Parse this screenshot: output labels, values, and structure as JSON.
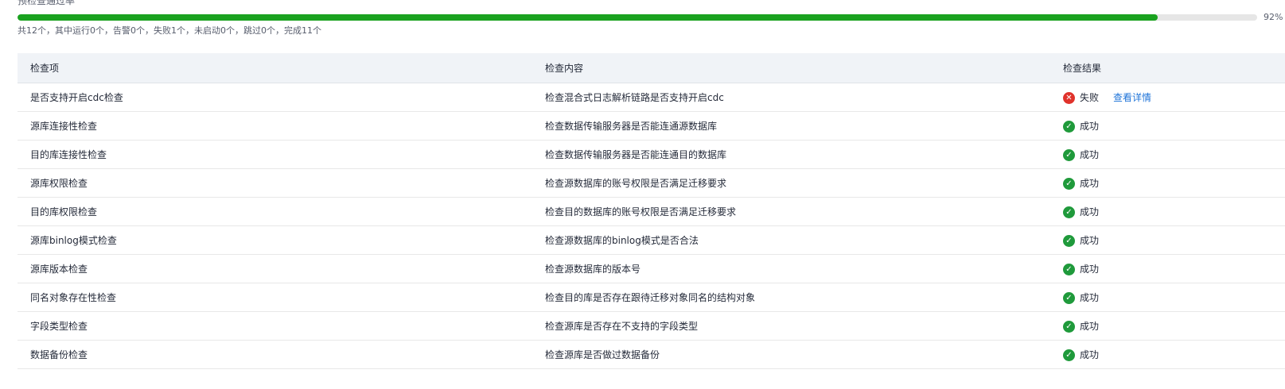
{
  "precheck": {
    "title": "预检查通过率",
    "progress_percent": 92,
    "progress_label": "92%",
    "summary": "共12个，其中运行0个，告警0个，失败1个，未启动0个，跳过0个，完成11个",
    "colors": {
      "progress": "#1aa21f",
      "track": "#e6e6e6",
      "success": "#1f9a3b",
      "fail": "#e0322b",
      "link": "#1e73d8",
      "header_bg": "#f0f3f7"
    }
  },
  "table": {
    "columns": [
      "检查项",
      "检查内容",
      "检查结果"
    ],
    "rows": [
      {
        "item": "是否支持开启cdc检查",
        "content": "检查混合式日志解析链路是否支持开启cdc",
        "result": "失败",
        "status": "fail",
        "link": "查看详情"
      },
      {
        "item": "源库连接性检查",
        "content": "检查数据传输服务器是否能连通源数据库",
        "result": "成功",
        "status": "success"
      },
      {
        "item": "目的库连接性检查",
        "content": "检查数据传输服务器是否能连通目的数据库",
        "result": "成功",
        "status": "success"
      },
      {
        "item": "源库权限检查",
        "content": "检查源数据库的账号权限是否满足迁移要求",
        "result": "成功",
        "status": "success"
      },
      {
        "item": "目的库权限检查",
        "content": "检查目的数据库的账号权限是否满足迁移要求",
        "result": "成功",
        "status": "success"
      },
      {
        "item": "源库binlog模式检查",
        "content": "检查源数据库的binlog模式是否合法",
        "result": "成功",
        "status": "success"
      },
      {
        "item": "源库版本检查",
        "content": "检查源数据库的版本号",
        "result": "成功",
        "status": "success"
      },
      {
        "item": "同名对象存在性检查",
        "content": "检查目的库是否存在跟待迁移对象同名的结构对象",
        "result": "成功",
        "status": "success"
      },
      {
        "item": "字段类型检查",
        "content": "检查源库是否存在不支持的字段类型",
        "result": "成功",
        "status": "success"
      },
      {
        "item": "数据备份检查",
        "content": "检查源库是否做过数据备份",
        "result": "成功",
        "status": "success"
      }
    ]
  }
}
